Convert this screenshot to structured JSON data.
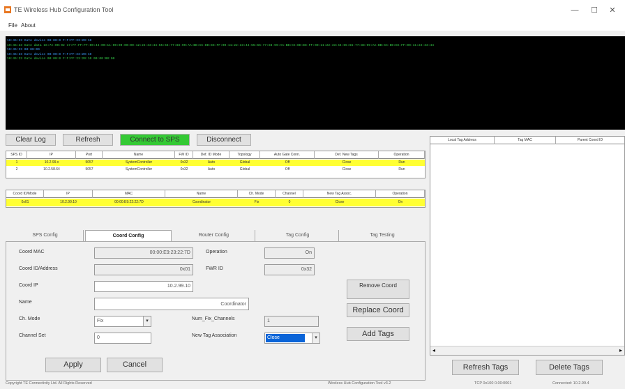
{
  "window": {
    "title": "TE Wireless Hub Configuration Tool",
    "menu": [
      "File",
      "About"
    ],
    "controls": {
      "minimize": "—",
      "maximize": "☐",
      "close": "✕"
    }
  },
  "log": {
    "lines": [
      "10:45:23 Gate device 00:00:0 F:F:FF:23:20:10",
      "10:45:23 Gate data 16:7A:00:02 17:FF:FF:FF:00:44:00:11:00:00:00:00:12:22:33:44:55:66:77:88:99:AA:BB:CC:DD:EE:FF:00:11:22:33:44:55:66:77:88:99:AA:BB:CC:DD:EE:FF:00:11:22:33:44:55:66:77:88:99:AA:BB:CC:DD:EE:FF:00:11:22:33:44",
      "10:45:23 00:00:00",
      "10:45:23 Gate device 00:00:0 F:F:FF:23:20:10",
      "10:45:23 Gate device 00:00:0 F:F:FF:23:20:10 00:00:00:00"
    ]
  },
  "toolbar": {
    "clear_log": "Clear Log",
    "refresh": "Refresh",
    "connect": "Connect to SPS",
    "disconnect": "Disconnect"
  },
  "sps_grid": {
    "columns": [
      "SPS ID",
      "IP",
      "Port",
      "Name",
      "FW ID",
      "Def. ID Mode",
      "Topology",
      "Auto Gate Conn.",
      "Def. New Tags",
      "Operation"
    ],
    "rows": [
      [
        "1",
        "10.2.99.x",
        "5057",
        "SystemController",
        "0x32",
        "Auto",
        "Global",
        "Off",
        "Close",
        "Run"
      ],
      [
        "2",
        "10.2.58.64",
        "5057",
        "SystemController",
        "0x32",
        "Auto",
        "Global",
        "Off",
        "Close",
        "Run"
      ]
    ]
  },
  "coord_grid": {
    "columns": [
      "Coord ID/Mode",
      "IP",
      "MAC",
      "Name",
      "Ch. Mode",
      "Channel",
      "New Tag Assoc.",
      "Operation"
    ],
    "rows": [
      [
        "0x01",
        "10.2.99.10",
        "00:00:E9:22:22:7D",
        "Coordinator",
        "Fix",
        "0",
        "Close",
        "On"
      ]
    ]
  },
  "tabs": [
    "SPS Config",
    "Coord Config",
    "Router Config",
    "Tag Config",
    "Tag Testing"
  ],
  "coord_config": {
    "coord_mac_label": "Coord MAC",
    "coord_mac": "00:00:E9:23:22:7D",
    "coord_id_label": "Coord ID/Address",
    "coord_id": "0x01",
    "coord_ip_label": "Coord IP",
    "coord_ip": "10.2.99.10",
    "name_label": "Name",
    "name": "Coordinator",
    "ch_mode_label": "Ch. Mode",
    "ch_mode": "Fix",
    "channel_set_label": "Channel Set",
    "channel_set": "0",
    "operation_label": "Operation",
    "operation": "On",
    "fw_id_label": "FWR ID",
    "fw_id": "0x32",
    "num_channels_label": "Num_Fix_Channels",
    "num_channels": "1",
    "new_tag_label": "New Tag Association",
    "new_tag": "Close",
    "remove_coord": "Remove Coord",
    "replace_coord": "Replace Coord",
    "add_tags": "Add Tags",
    "apply": "Apply",
    "cancel": "Cancel"
  },
  "tag_list": {
    "columns": [
      "Local Tag Address",
      "Tag MAC",
      "Parent Coord ID"
    ],
    "refresh_tags": "Refresh Tags",
    "delete_tags": "Delete Tags"
  },
  "status": {
    "left": "Copyright TE Connectivity Ltd. All Rights Reserved",
    "mid": "Wireless Hub Configuration Tool v3.2",
    "right1": "TCP 0x100 0.00:0001",
    "right2": "Connected: 10.2.99.4"
  },
  "colors": {
    "log_bg": "#000000",
    "log_text": "#3ea0ff",
    "selected_row": "#ffff33",
    "connect_button": "#34c934",
    "dropdown_selected": "#0a64d8"
  }
}
